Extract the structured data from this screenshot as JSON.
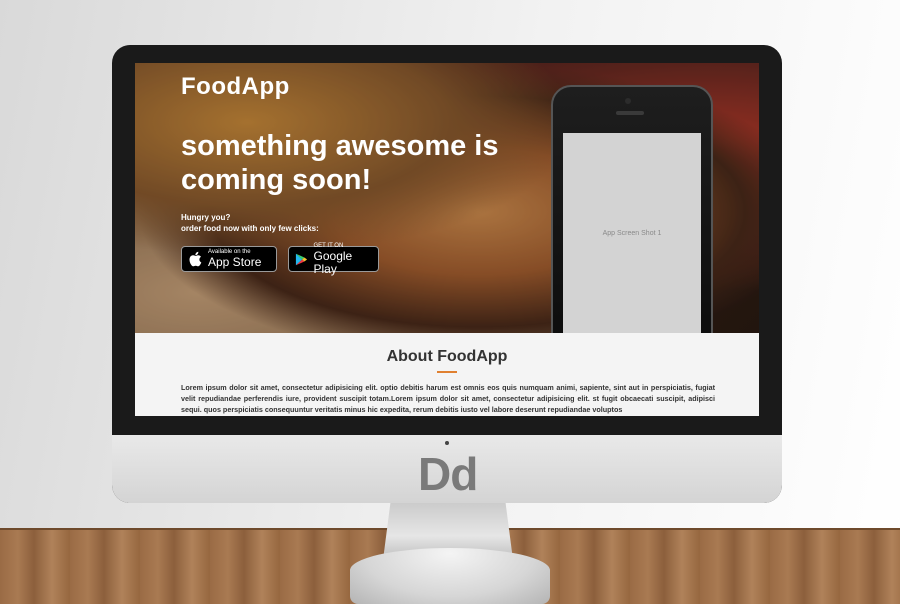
{
  "app": {
    "brand": "FoodApp",
    "headline": "something awesome is coming soon!",
    "tagline_line1": "Hungry you?",
    "tagline_line2": "order food now with only few clicks:",
    "app_store_small": "Available on the",
    "app_store_big": "App Store",
    "google_play_small": "GET IT ON",
    "google_play_big": "Google Play",
    "phone_placeholder": "App Screen Shot 1"
  },
  "about": {
    "title": "About FoodApp",
    "text": "Lorem ipsum dolor sit amet, consectetur adipisicing elit. optio debitis harum est omnis eos quis numquam animi, sapiente, sint aut in perspiciatis, fugiat velit repudiandae perferendis iure, provident suscipit totam.Lorem ipsum dolor sit amet, consectetur adipisicing elit. st fugit obcaecati suscipit, adipisci sequi. quos perspiciatis consequuntur veritatis minus hic expedita, rerum debitis iusto vel labore deserunt repudiandae voluptos"
  },
  "monitor": {
    "logo": "Dd"
  },
  "colors": {
    "accent": "#e08030",
    "button_bg": "#000000",
    "placeholder": "#d3d3d3"
  }
}
